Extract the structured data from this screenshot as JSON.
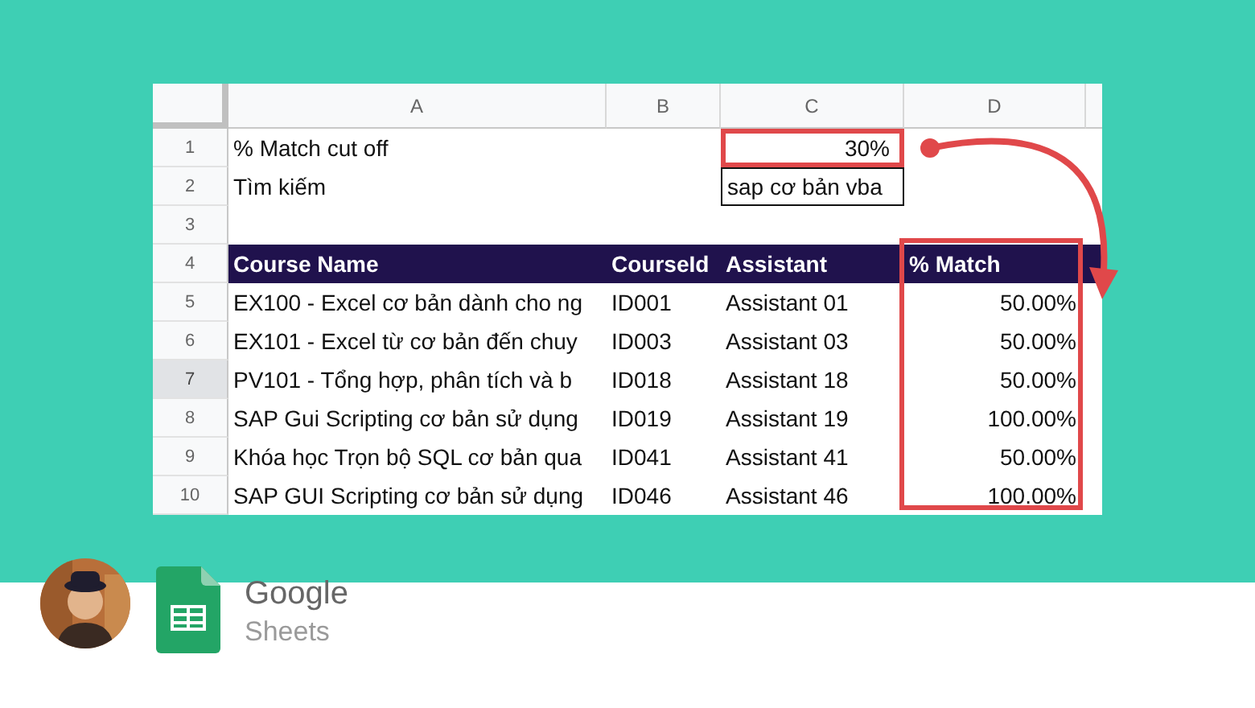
{
  "sheet": {
    "column_headers": [
      "A",
      "B",
      "C",
      "D"
    ],
    "rows": [
      {
        "number": "1",
        "selected": false,
        "kind": "plain",
        "cells": {
          "a": {
            "text": "% Match cut off"
          },
          "c": {
            "text": "30%",
            "right_aligned": true,
            "highlighted": true
          }
        }
      },
      {
        "number": "2",
        "selected": false,
        "kind": "plain",
        "cells": {
          "a": {
            "text": "Tìm kiếm"
          },
          "c": {
            "text": "sap cơ bản vba",
            "boxed": true
          }
        }
      },
      {
        "number": "3",
        "selected": false,
        "kind": "plain",
        "cells": {}
      },
      {
        "number": "4",
        "selected": false,
        "kind": "header",
        "cells": {
          "a": {
            "text": "Course Name"
          },
          "b": {
            "text": "CourseId"
          },
          "c": {
            "text": "Assistant"
          },
          "d": {
            "text": "% Match"
          }
        }
      },
      {
        "number": "5",
        "selected": false,
        "kind": "plain",
        "cells": {
          "a": {
            "text": "EX100 - Excel cơ bản dành cho ng"
          },
          "b": {
            "text": "ID001"
          },
          "c": {
            "text": "Assistant 01"
          },
          "d": {
            "text": "50.00%",
            "right_aligned": true
          }
        }
      },
      {
        "number": "6",
        "selected": false,
        "kind": "plain",
        "cells": {
          "a": {
            "text": "EX101 - Excel từ cơ bản đến chuy"
          },
          "b": {
            "text": "ID003"
          },
          "c": {
            "text": "Assistant 03"
          },
          "d": {
            "text": "50.00%",
            "right_aligned": true
          }
        }
      },
      {
        "number": "7",
        "selected": true,
        "kind": "plain",
        "cells": {
          "a": {
            "text": "PV101 - Tổng hợp, phân tích và b"
          },
          "b": {
            "text": "ID018"
          },
          "c": {
            "text": "Assistant 18"
          },
          "d": {
            "text": "50.00%",
            "right_aligned": true
          }
        }
      },
      {
        "number": "8",
        "selected": false,
        "kind": "plain",
        "cells": {
          "a": {
            "text": "SAP Gui Scripting cơ bản sử dụng"
          },
          "b": {
            "text": "ID019"
          },
          "c": {
            "text": "Assistant 19"
          },
          "d": {
            "text": "100.00%",
            "right_aligned": true
          }
        }
      },
      {
        "number": "9",
        "selected": false,
        "kind": "plain",
        "cells": {
          "a": {
            "text": "Khóa học Trọn bộ SQL cơ bản qua"
          },
          "b": {
            "text": "ID041"
          },
          "c": {
            "text": "Assistant 41"
          },
          "d": {
            "text": "50.00%",
            "right_aligned": true
          }
        }
      },
      {
        "number": "10",
        "selected": false,
        "kind": "plain",
        "cells": {
          "a": {
            "text": "SAP GUI Scripting cơ bản sử dụng"
          },
          "b": {
            "text": "ID046"
          },
          "c": {
            "text": "Assistant 46"
          },
          "d": {
            "text": "100.00%",
            "right_aligned": true
          }
        }
      }
    ]
  },
  "annotations": {
    "match_range_box": true,
    "arrow": true
  },
  "footer": {
    "brand": "Google",
    "product": "Sheets"
  }
}
